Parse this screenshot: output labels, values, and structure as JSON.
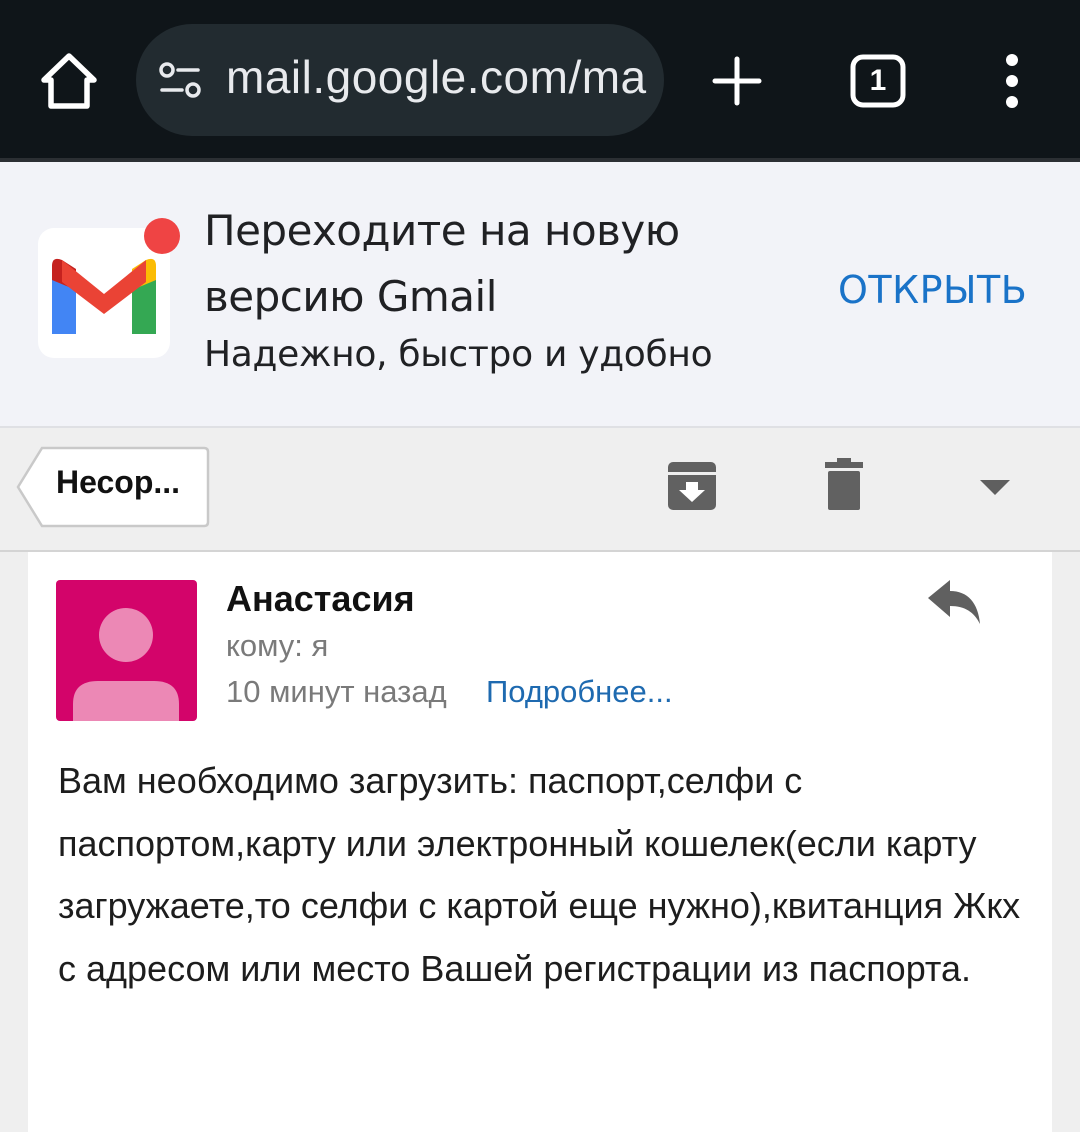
{
  "browser": {
    "url": "mail.google.com/ma",
    "tab_count": "1",
    "icons": [
      "home-icon",
      "site-settings-icon",
      "new-tab-icon",
      "tab-switcher-icon",
      "more-vert-icon"
    ]
  },
  "promo": {
    "title": "Переходите на новую версию Gmail",
    "subtitle": "Надежно, быстро и удобно",
    "open_label": "ОТКРЫТЬ",
    "accent_color": "#1a73c8",
    "badge_color": "#ef4444"
  },
  "toolbar": {
    "back_label": "Несор...",
    "icons": [
      "archive-icon",
      "delete-icon",
      "dropdown-icon"
    ]
  },
  "message": {
    "sender": "Анастасия",
    "recipient": "кому: я",
    "time": "10 минут назад",
    "details_label": "Подробнее...",
    "avatar_color": "#d3046a",
    "body": "Вам необходимо загрузить: паспорт,селфи с паспортом,карту или электронный кошелек(если карту загружаете,то селфи с картой еще нужно),квитанция Жкх с адресом или место Вашей регистрации из паспорта."
  }
}
